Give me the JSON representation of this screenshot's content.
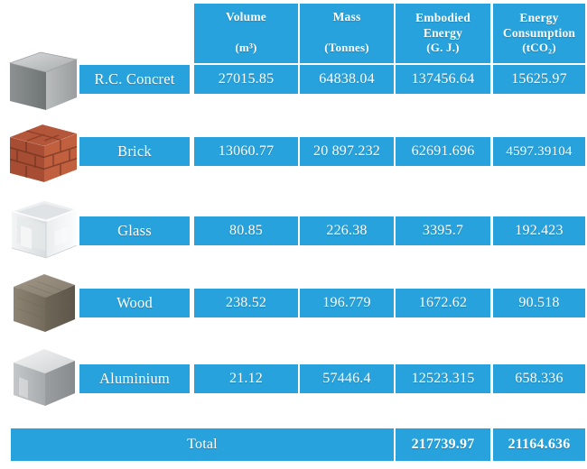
{
  "table": {
    "row_label_header": "",
    "columns": [
      {
        "name": "Volume",
        "unit": "m3",
        "unit_text": "(m³)"
      },
      {
        "name": "Mass",
        "unit": "Tonnes",
        "unit_text": "(Tonnes)"
      },
      {
        "name": "Embodied Energy",
        "unit": "G. J.",
        "unit_text": "(G. J.)"
      },
      {
        "name": "Energy Consumption",
        "unit": "tCO2",
        "unit_text": "(tCO₂)"
      }
    ],
    "header_lines": [
      {
        "l1": "Volume",
        "l2": "",
        "unit": "(m³)"
      },
      {
        "l1": "Mass",
        "l2": "",
        "unit": "(Tonnes)"
      },
      {
        "l1": "Embodied",
        "l2": "Energy",
        "unit": "(G. J.)"
      },
      {
        "l1": "Energy",
        "l2": "Consumption",
        "unit": "(tCO₂)"
      }
    ],
    "rows": [
      {
        "material": "R.C. Concret",
        "icon": "concrete-cube-icon",
        "volume": "27015.85",
        "mass": "64838.04",
        "embodied_energy": "137456.64",
        "energy_consumption": "15625.97"
      },
      {
        "material": "Brick",
        "icon": "brick-cube-icon",
        "volume": "13060.77",
        "mass": "20 897.232",
        "embodied_energy": "62691.696",
        "energy_consumption": "4597.39104"
      },
      {
        "material": "Glass",
        "icon": "glass-cube-icon",
        "volume": "80.85",
        "mass": "226.38",
        "embodied_energy": "3395.7",
        "energy_consumption": "192.423"
      },
      {
        "material": "Wood",
        "icon": "wood-cube-icon",
        "volume": "238.52",
        "mass": "196.779",
        "embodied_energy": "1672.62",
        "energy_consumption": "90.518"
      },
      {
        "material": "Aluminium",
        "icon": "aluminium-cube-icon",
        "volume": "21.12",
        "mass": "57446.4",
        "embodied_energy": "12523.315",
        "energy_consumption": "658.336"
      }
    ],
    "total": {
      "label": "Total",
      "embodied_energy": "217739.97",
      "energy_consumption": "21164.636"
    }
  },
  "chart_data": {
    "type": "table",
    "title": "",
    "categories": [
      "R.C. Concret",
      "Brick",
      "Glass",
      "Wood",
      "Aluminium"
    ],
    "columns": [
      "Volume (m³)",
      "Mass (Tonnes)",
      "Embodied Energy (G. J.)",
      "Energy Consumption (tCO₂)"
    ],
    "series": [
      {
        "name": "Volume (m³)",
        "values": [
          27015.85,
          13060.77,
          80.85,
          238.52,
          21.12
        ]
      },
      {
        "name": "Mass (Tonnes)",
        "values": [
          64838.04,
          20897.232,
          226.38,
          196.779,
          57446.4
        ]
      },
      {
        "name": "Embodied Energy (G. J.)",
        "values": [
          137456.64,
          62691.696,
          3395.7,
          1672.62,
          12523.315
        ]
      },
      {
        "name": "Energy Consumption (tCO₂)",
        "values": [
          15625.97,
          4597.39104,
          192.423,
          90.518,
          658.336
        ]
      }
    ],
    "totals": {
      "Embodied Energy (G. J.)": 217739.97,
      "Energy Consumption (tCO₂)": 21164.636
    }
  },
  "colors": {
    "cell_blue": "#27a2dc",
    "text_white": "#ffffff",
    "background": "#ffffff"
  }
}
